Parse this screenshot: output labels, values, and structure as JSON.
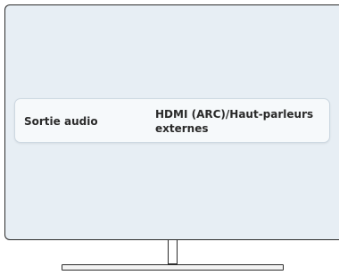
{
  "settings": {
    "rows": [
      {
        "label": "Sortie audio",
        "value": "HDMI (ARC)/Haut-parleurs externes"
      }
    ]
  },
  "colors": {
    "screen_background": "#e7eef4",
    "row_background": "#f6f9fb",
    "text": "#2a2a2a",
    "frame": "#2b2b2b"
  }
}
